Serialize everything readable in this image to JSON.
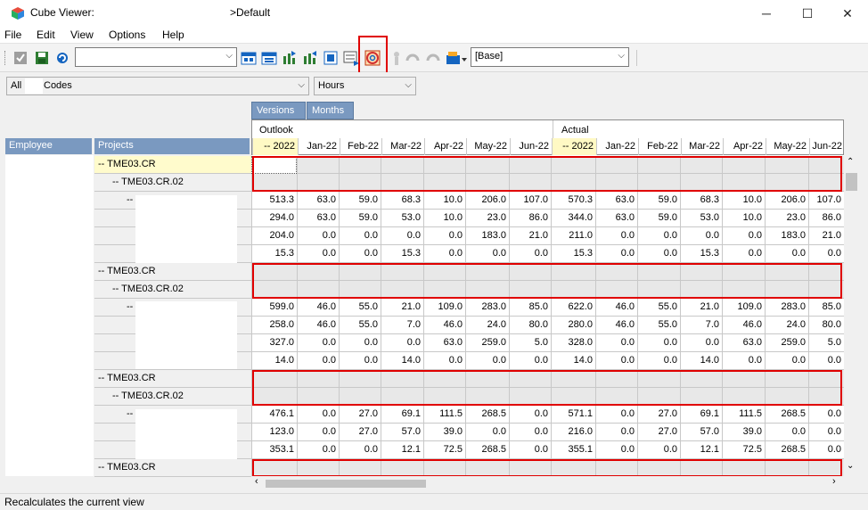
{
  "window": {
    "title": "Cube Viewer:",
    "view_name": ">Default",
    "minimize_glyph": "─",
    "maximize_glyph": "☐",
    "close_glyph": "✕"
  },
  "menu": {
    "items": [
      "File",
      "Edit",
      "View",
      "Options",
      "Help"
    ]
  },
  "toolbar": {
    "icons": [
      "check-icon",
      "save-icon",
      "refresh-icon",
      "export-icon",
      "export-icon",
      "zoom-in-icon",
      "zoom-out-icon",
      "properties-icon",
      "suppress-zeros-icon",
      "recalculate-icon",
      "sandbox-icon",
      "undo-icon",
      "redo-icon",
      "tools-icon"
    ],
    "base_combo": "[Base]"
  },
  "filters": {
    "codes_prefix": "All",
    "codes_label": "Codes",
    "measure": "Hours"
  },
  "dimension_tabs": [
    "Versions",
    "Months"
  ],
  "row_headers": [
    "Employee",
    "Projects"
  ],
  "measures": [
    "Outlook",
    "Actual"
  ],
  "columns": [
    "-- 2022",
    "Jan-22",
    "Feb-22",
    "Mar-22",
    "Apr-22",
    "May-22",
    "Jun-22",
    "-- 2022",
    "Jan-22",
    "Feb-22",
    "Mar-22",
    "Apr-22",
    "May-22",
    "Jun-22"
  ],
  "rows": [
    {
      "label": "-- TME03.CR",
      "indent": 0,
      "blank": true
    },
    {
      "label": "-- TME03.CR.02",
      "indent": 1,
      "blank": true
    },
    {
      "label": "-- (",
      "indent": 2,
      "values": [
        "513.3",
        "63.0",
        "59.0",
        "68.3",
        "10.0",
        "206.0",
        "107.0",
        "570.3",
        "63.0",
        "59.0",
        "68.3",
        "10.0",
        "206.0",
        "107.0"
      ]
    },
    {
      "label": "",
      "indent": 2,
      "values": [
        "294.0",
        "63.0",
        "59.0",
        "53.0",
        "10.0",
        "23.0",
        "86.0",
        "344.0",
        "63.0",
        "59.0",
        "53.0",
        "10.0",
        "23.0",
        "86.0"
      ]
    },
    {
      "label": "",
      "indent": 2,
      "values": [
        "204.0",
        "0.0",
        "0.0",
        "0.0",
        "0.0",
        "183.0",
        "21.0",
        "211.0",
        "0.0",
        "0.0",
        "0.0",
        "0.0",
        "183.0",
        "21.0"
      ]
    },
    {
      "label": "",
      "indent": 2,
      "values": [
        "15.3",
        "0.0",
        "0.0",
        "15.3",
        "0.0",
        "0.0",
        "0.0",
        "15.3",
        "0.0",
        "0.0",
        "15.3",
        "0.0",
        "0.0",
        "0.0"
      ]
    },
    {
      "label": "-- TME03.CR",
      "indent": 0,
      "blank": true
    },
    {
      "label": "-- TME03.CR.02",
      "indent": 1,
      "blank": true
    },
    {
      "label": "--",
      "indent": 2,
      "values": [
        "599.0",
        "46.0",
        "55.0",
        "21.0",
        "109.0",
        "283.0",
        "85.0",
        "622.0",
        "46.0",
        "55.0",
        "21.0",
        "109.0",
        "283.0",
        "85.0"
      ]
    },
    {
      "label": "",
      "indent": 2,
      "values": [
        "258.0",
        "46.0",
        "55.0",
        "7.0",
        "46.0",
        "24.0",
        "80.0",
        "280.0",
        "46.0",
        "55.0",
        "7.0",
        "46.0",
        "24.0",
        "80.0"
      ]
    },
    {
      "label": "",
      "indent": 2,
      "values": [
        "327.0",
        "0.0",
        "0.0",
        "0.0",
        "63.0",
        "259.0",
        "5.0",
        "328.0",
        "0.0",
        "0.0",
        "0.0",
        "63.0",
        "259.0",
        "5.0"
      ]
    },
    {
      "label": "",
      "indent": 2,
      "values": [
        "14.0",
        "0.0",
        "0.0",
        "14.0",
        "0.0",
        "0.0",
        "0.0",
        "14.0",
        "0.0",
        "0.0",
        "14.0",
        "0.0",
        "0.0",
        "0.0"
      ]
    },
    {
      "label": "-- TME03.CR",
      "indent": 0,
      "blank": true
    },
    {
      "label": "-- TME03.CR.02",
      "indent": 1,
      "blank": true
    },
    {
      "label": "-- (",
      "indent": 2,
      "values": [
        "476.1",
        "0.0",
        "27.0",
        "69.1",
        "111.5",
        "268.5",
        "0.0",
        "571.1",
        "0.0",
        "27.0",
        "69.1",
        "111.5",
        "268.5",
        "0.0"
      ]
    },
    {
      "label": "",
      "indent": 2,
      "values": [
        "123.0",
        "0.0",
        "27.0",
        "57.0",
        "39.0",
        "0.0",
        "0.0",
        "216.0",
        "0.0",
        "27.0",
        "57.0",
        "39.0",
        "0.0",
        "0.0"
      ]
    },
    {
      "label": "",
      "indent": 2,
      "values": [
        "353.1",
        "0.0",
        "0.0",
        "12.1",
        "72.5",
        "268.5",
        "0.0",
        "355.1",
        "0.0",
        "0.0",
        "12.1",
        "72.5",
        "268.5",
        "0.0"
      ]
    },
    {
      "label": "-- TME03.CR",
      "indent": 0,
      "blank": true
    }
  ],
  "status": "Recalculates the current view",
  "colors": {
    "header_blue": "#7a99c0",
    "highlight_red": "#e00000",
    "selected_yellow": "#fffbcc"
  }
}
